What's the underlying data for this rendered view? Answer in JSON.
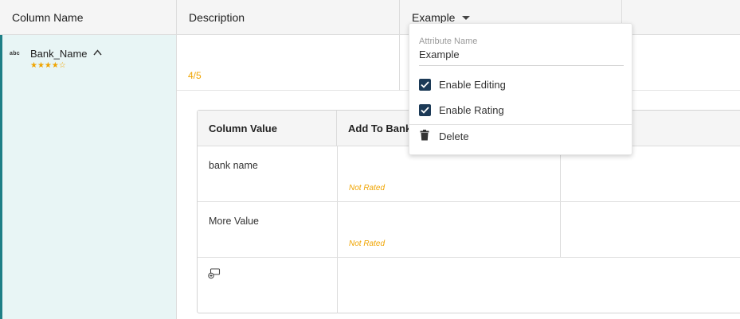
{
  "header": {
    "col1": "Column Name",
    "col2": "Description",
    "col3": "Example"
  },
  "column": {
    "type_icon": "abc",
    "name": "Bank_Name",
    "rating_stars": "★★★★☆",
    "rating_value": 4,
    "rating_max": 5,
    "rating_text": "4/5"
  },
  "inner_table": {
    "headers": [
      "Column Value",
      "Add To Bank"
    ],
    "rows": [
      {
        "value": "bank name",
        "status": "Not Rated"
      },
      {
        "value": "More Value",
        "status": "Not Rated"
      }
    ],
    "add_icon": "add-value-icon"
  },
  "dropdown": {
    "attr_label": "Attribute Name",
    "attr_value": "Example",
    "options": [
      {
        "label": "Enable Editing",
        "checked": true
      },
      {
        "label": "Enable Rating",
        "checked": true
      }
    ],
    "delete_label": "Delete"
  },
  "colors": {
    "accent": "#1e7f86",
    "selected_bg": "#e8f5f5",
    "rating": "#f0a400",
    "checkbox": "#1c3a57"
  }
}
